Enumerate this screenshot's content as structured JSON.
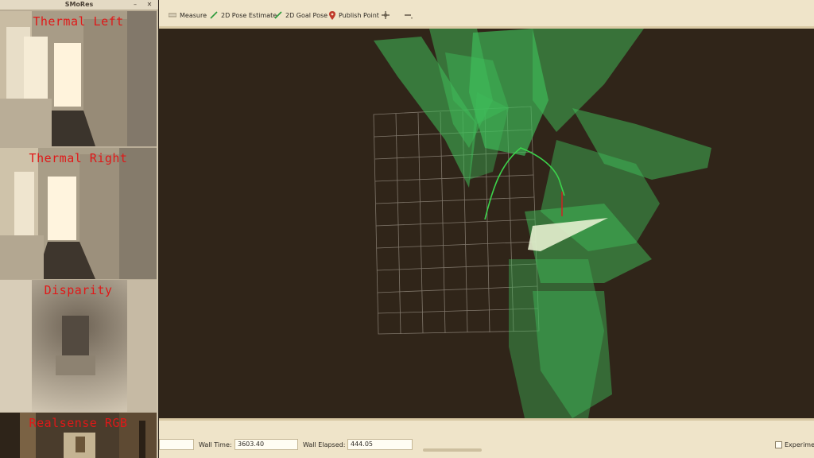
{
  "image_window": {
    "title": "SMoRes",
    "minimize_icon": "minimize-icon",
    "close_icon": "close-icon",
    "panels": [
      {
        "label": "Thermal Left"
      },
      {
        "label": "Thermal Right"
      },
      {
        "label": "Disparity"
      },
      {
        "label": "Realsense RGB"
      }
    ]
  },
  "toolbar": {
    "measure": "Measure",
    "pose_estimate": "2D Pose Estimate",
    "goal_pose": "2D Goal Pose",
    "publish_point": "Publish Point",
    "icons": [
      "ruler-icon",
      "green-arrow-icon",
      "green-arrow-icon",
      "map-pin-icon",
      "move-camera-icon",
      "minus-icon"
    ]
  },
  "status": {
    "wall_time_label": "Wall Time:",
    "wall_time_value": "3603.40",
    "wall_elapsed_label": "Wall Elapsed:",
    "wall_elapsed_value": "444.05",
    "experiment_label": "Experime"
  },
  "colors": {
    "viewport_bg": "#302519",
    "point_cloud": "#3fbf5a",
    "label_red": "#e01818",
    "toolbar_bg": "#efe4c9"
  }
}
